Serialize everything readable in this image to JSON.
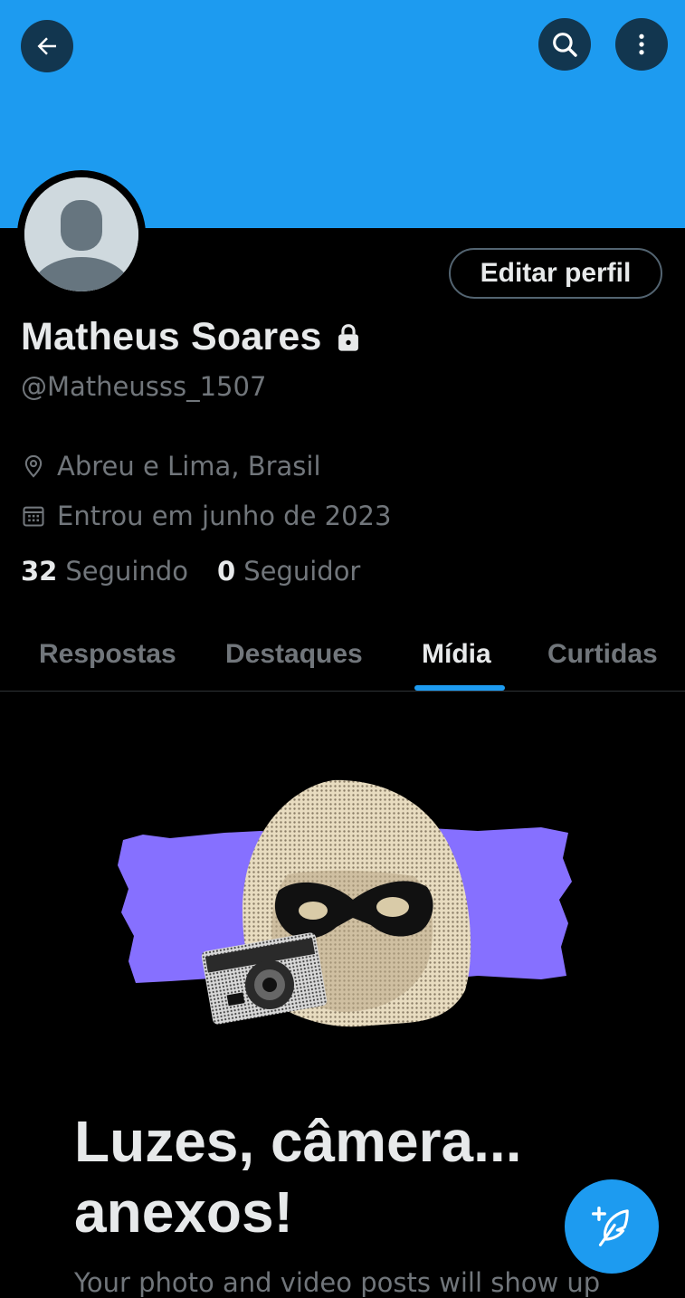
{
  "header": {
    "back_icon": "arrow-left-icon",
    "search_icon": "search-icon",
    "more_icon": "more-vertical-icon"
  },
  "profile": {
    "edit_label": "Editar perfil",
    "display_name": "Matheus Soares",
    "protected_icon": "lock-icon",
    "handle": "@Matheusss_1507",
    "location": "Abreu e Lima, Brasil",
    "joined": "Entrou em junho de 2023",
    "following_count": "32",
    "following_label": "Seguindo",
    "followers_count": "0",
    "followers_label": "Seguidor"
  },
  "tabs": [
    {
      "label": "Respostas",
      "active": false
    },
    {
      "label": "Destaques",
      "active": false
    },
    {
      "label": "Mídia",
      "active": true
    },
    {
      "label": "Curtidas",
      "active": false
    }
  ],
  "empty_state": {
    "title": "Luzes, câmera... anexos!",
    "subtitle": "Your photo and video posts will show up"
  },
  "fab": {
    "icon": "compose-feather-icon"
  },
  "colors": {
    "accent": "#1d9bf0",
    "background": "#000000",
    "text_primary": "#e7e9ea",
    "text_secondary": "#71767b",
    "illustration_purple": "#8670ff"
  }
}
